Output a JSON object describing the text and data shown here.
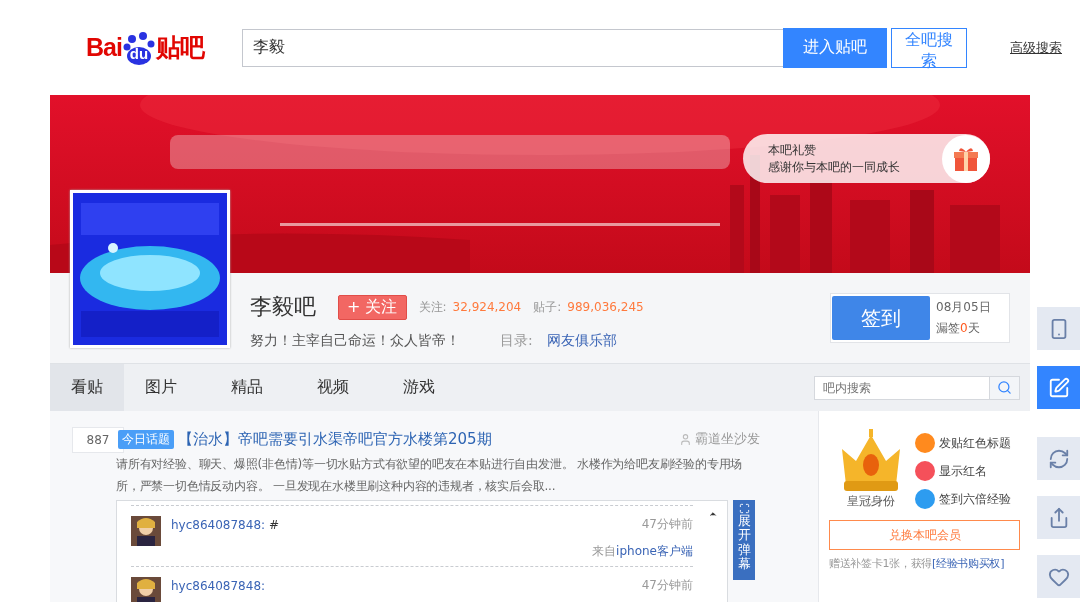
{
  "header": {
    "logo": {
      "left": "Bai",
      "paw": "du",
      "right": "贴吧"
    },
    "search": {
      "value": "李毅"
    },
    "buttons": [
      {
        "label": "进入贴吧",
        "kind": "primary"
      },
      {
        "label": "全吧搜索",
        "kind": "outline"
      }
    ],
    "advanced_link": "高级搜索"
  },
  "banner": {
    "kind": "picture",
    "gift": {
      "title": "本吧礼赞",
      "subtitle": "感谢你与本吧的一同成长"
    }
  },
  "forum": {
    "name": "李毅吧",
    "follow_button": "+ 关注",
    "stats": [
      {
        "label": "关注:",
        "value": "32,924,204"
      },
      {
        "label": "贴子:",
        "value": "989,036,245"
      }
    ],
    "slogan": "努力！主宰自己命运！众人皆帝！",
    "directory_label": "目录:",
    "directory": "网友俱乐部"
  },
  "sign_in": {
    "button": "签到",
    "date": "08月05日",
    "missed_prefix": "漏签",
    "missed_count": "0",
    "missed_suffix": "天"
  },
  "tabs": [
    {
      "label": "看贴",
      "selected": true
    },
    {
      "label": "图片",
      "selected": false
    },
    {
      "label": "精品",
      "selected": false
    },
    {
      "label": "视频",
      "selected": false
    },
    {
      "label": "游戏",
      "selected": false
    }
  ],
  "forum_search": {
    "placeholder": "吧内搜索"
  },
  "post": {
    "reply_count": "887",
    "badge": "今日话题",
    "title": "【治水】帝吧需要引水渠帝吧官方水楼第205期",
    "author": "霸道坐沙发",
    "summary": "请所有对经验、聊天、爆照(非色情)等一切水贴方式有欲望的吧友在本贴进行自由发泄。 水楼作为给吧友刷经验的专用场所，严禁一切色情反动内容。 一旦发现在水楼里刷这种内容的违规者，核实后会取...",
    "danmaku_toggle": "展开弹幕",
    "replies": [
      {
        "user": "hyc864087848:",
        "text": "#",
        "time": "47分钟前",
        "source_prefix": "来自",
        "source": "iphone客户端"
      },
      {
        "user": "hyc864087848:",
        "time": "47分钟前"
      }
    ]
  },
  "membership": {
    "crown_label": "皇冠身份",
    "perks": [
      {
        "label": "发贴红色标题",
        "color": "#ff8a1e"
      },
      {
        "label": "显示红名",
        "color": "#f5505a"
      },
      {
        "label": "签到六倍经验",
        "color": "#2d9cf0"
      }
    ],
    "button": "兑换本吧会员",
    "note_prefix": "赠送补签卡1张，获得",
    "note_link": "[经验书购买权]"
  },
  "side_toolbar": [
    {
      "kind": "download",
      "selected": false
    },
    {
      "kind": "edit",
      "selected": true
    },
    {
      "kind": "refresh",
      "selected": false
    },
    {
      "kind": "share",
      "selected": false
    },
    {
      "kind": "favorite",
      "selected": false
    }
  ]
}
